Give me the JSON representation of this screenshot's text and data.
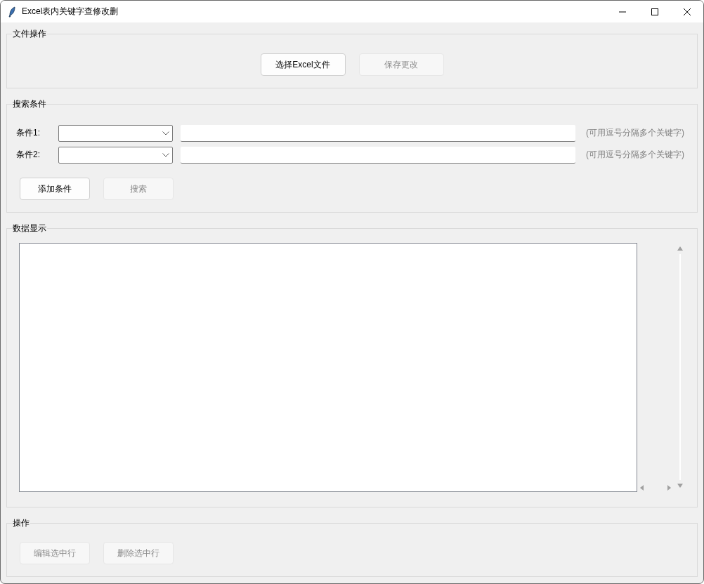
{
  "window": {
    "title": "Excel表内关键字查修改删"
  },
  "file_ops": {
    "title": "文件操作",
    "buttons": [
      {
        "label": "选择Excel文件",
        "disabled": false
      },
      {
        "label": "保存更改",
        "disabled": true
      }
    ]
  },
  "search": {
    "title": "搜索条件",
    "conditions": [
      {
        "label": "条件1:",
        "hint": "(可用逗号分隔多个关键字)"
      },
      {
        "label": "条件2:",
        "hint": "(可用逗号分隔多个关键字)"
      }
    ],
    "buttons": [
      {
        "label": "添加条件",
        "disabled": false
      },
      {
        "label": "搜索",
        "disabled": true
      }
    ]
  },
  "data": {
    "title": "数据显示"
  },
  "actions": {
    "title": "操作",
    "buttons": [
      {
        "label": "编辑选中行",
        "disabled": true
      },
      {
        "label": "删除选中行",
        "disabled": true
      }
    ]
  }
}
